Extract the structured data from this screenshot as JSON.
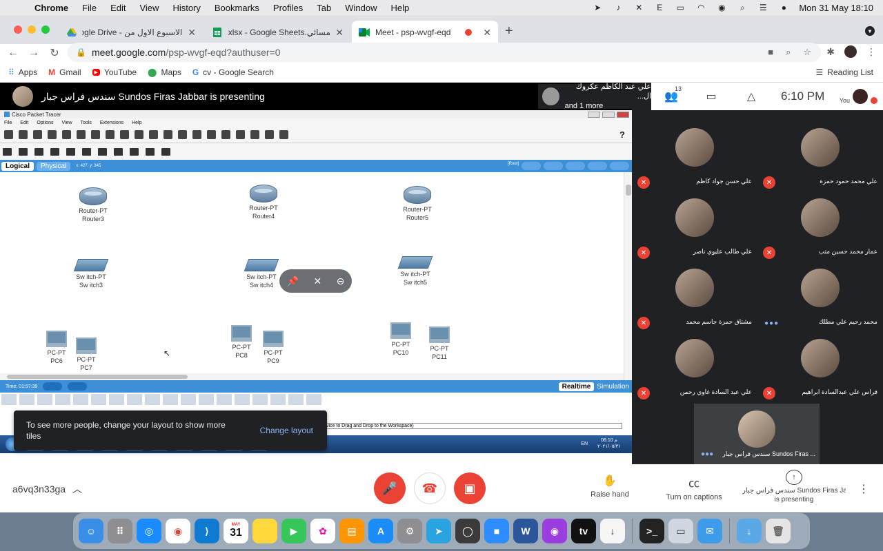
{
  "menubar": {
    "app": "Chrome",
    "items": [
      "File",
      "Edit",
      "View",
      "History",
      "Bookmarks",
      "Profiles",
      "Tab",
      "Window",
      "Help"
    ],
    "datetime": "Mon 31 May  18:10"
  },
  "tabs": [
    {
      "title": "الاسبوع الاول من - Google Drive",
      "icon": "drive-icon"
    },
    {
      "title": "xlsx - Google Sheets.المسائي",
      "icon": "sheets-icon"
    },
    {
      "title": "Meet - psp-wvgf-eqd",
      "icon": "meet-icon"
    }
  ],
  "omnibox": {
    "host": "meet.google.com",
    "path": "/psp-wvgf-eqd?authuser=0"
  },
  "bookmarks": {
    "items": [
      "Apps",
      "Gmail",
      "YouTube",
      "Maps",
      "cv - Google Search"
    ],
    "reading_list": "Reading List"
  },
  "meet": {
    "presenter_banner": "سندس فراس جبار Sundos Firas Jabbar is presenting",
    "speaker": {
      "line1": "علي عبد الكاظم عكروك ال...",
      "line2": "and 1 more"
    },
    "people_count": "13",
    "clock": "6:10  PM",
    "you_label": "You",
    "toast": {
      "message": "To see more people, change your layout to show more tiles",
      "action": "Change layout"
    },
    "participants": [
      {
        "name": "علي حسن جواد كاظم"
      },
      {
        "name": "علي محمد حمود حمزة"
      },
      {
        "name": "علي طالب عليوي ناصر"
      },
      {
        "name": "عمار محمد حسين متب"
      },
      {
        "name": "مشتاق حمزة جاسم محمد"
      },
      {
        "name": "محمد رحيم علي مطلك"
      },
      {
        "name": "علي عبد السادة غاوي رحمن"
      },
      {
        "name": "فراس علي عبدالسادة ابراهيم"
      }
    ],
    "self_tile": {
      "name": "سندس فراس جبار Sundos Firas ..."
    },
    "bottom": {
      "meeting_code": "a6vq3n33ga",
      "raise_hand": "Raise hand",
      "captions": "Turn on captions",
      "presenting_line1": "سندس فراس جبار Sundos Firas Jab...",
      "presenting_line2": "is presenting"
    }
  },
  "packet_tracer": {
    "title": "Cisco Packet Tracer",
    "menu": [
      "File",
      "Edit",
      "Options",
      "View",
      "Tools",
      "Extensions",
      "Help"
    ],
    "help": "?",
    "logical": "Logical",
    "physical": "Physical",
    "coords": "x: 427, y: 345",
    "root": "[Root]",
    "devices": [
      {
        "type": "Router-PT",
        "name": "Router3"
      },
      {
        "type": "Router-PT",
        "name": "Router4"
      },
      {
        "type": "Router-PT",
        "name": "Router5"
      },
      {
        "type": "Sw itch-PT",
        "name": "Sw itch3"
      },
      {
        "type": "Sw itch-PT",
        "name": "Sw itch4"
      },
      {
        "type": "Sw itch-PT",
        "name": "Sw itch5"
      },
      {
        "type": "PC-PT",
        "name": "PC6"
      },
      {
        "type": "PC-PT",
        "name": "PC7"
      },
      {
        "type": "PC-PT",
        "name": "PC8"
      },
      {
        "type": "PC-PT",
        "name": "PC9"
      },
      {
        "type": "PC-PT",
        "name": "PC10"
      },
      {
        "type": "PC-PT",
        "name": "PC11"
      }
    ],
    "time": "Time: 01:57:39",
    "realtime": "Realtime",
    "simulation": "Simulation",
    "hint": "vice to Drag and Drop to the Workspace)",
    "taskbar_lang": "EN",
    "taskbar_time": "06:10 م",
    "taskbar_date": "٢٠٢١/٠٥/٣١"
  },
  "dock": {
    "calendar_month": "MAY",
    "calendar_day": "31"
  }
}
